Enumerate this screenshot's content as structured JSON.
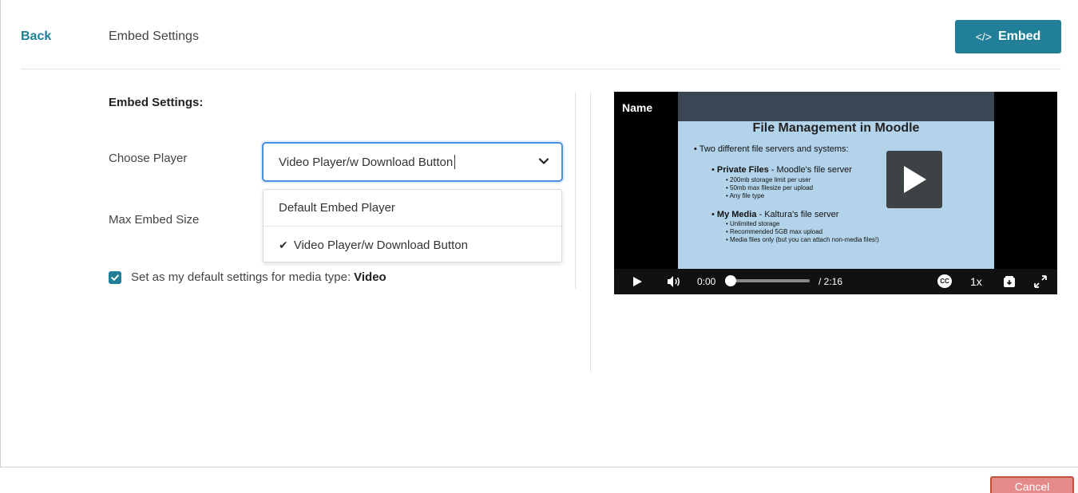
{
  "header": {
    "back_label": "Back",
    "title": "Embed Settings",
    "embed_icon": "code-icon",
    "embed_glyph": "</>",
    "embed_label": "Embed"
  },
  "form": {
    "section_title": "Embed Settings:",
    "choose_player_label": "Choose Player",
    "max_embed_size_label": "Max Embed Size",
    "selected_player": "Video Player/w Download Button",
    "options": [
      {
        "label": "Default Embed Player",
        "selected": false
      },
      {
        "label": "Video Player/w Download Button",
        "selected": true
      }
    ],
    "check_glyph": "✔",
    "default_checkbox": {
      "checked": true,
      "label": "Set as my default settings for media type:",
      "media_type": "Video"
    }
  },
  "player": {
    "name": "Name",
    "slide": {
      "title": "File Management in Moodle",
      "lines": [
        {
          "level": 1,
          "text": "Two different file servers and systems:"
        },
        {
          "level": 2,
          "bold": "Private Files",
          "text": " - Moodle's file server"
        },
        {
          "level": 3,
          "text": "200mb storage limit per user"
        },
        {
          "level": 3,
          "text": "50mb max filesize per upload"
        },
        {
          "level": 3,
          "text": "Any file type"
        },
        {
          "level": 2,
          "bold": "My Media",
          "text": " - Kaltura's file server"
        },
        {
          "level": 3,
          "text": "Unlimited storage"
        },
        {
          "level": 3,
          "text": "Recommended 5GB max upload"
        },
        {
          "level": 3,
          "text": "Media files only (but you can attach non-media files!)"
        }
      ]
    },
    "current_time": "0:00",
    "duration": "/ 2:16",
    "progress": 0,
    "cc_label": "CC",
    "speed": "1x",
    "colors": {
      "accent": "#227f98",
      "focus": "#4a90e2",
      "cancel": "#e58a8a"
    }
  },
  "footer": {
    "cancel_label": "Cancel"
  }
}
